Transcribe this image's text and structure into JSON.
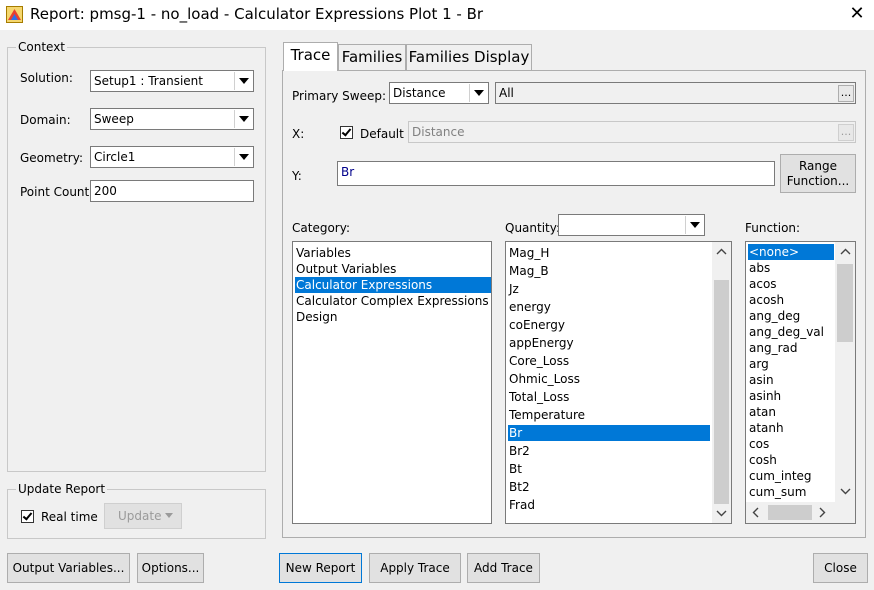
{
  "window": {
    "title": "Report: pmsg-1 - no_load - Calculator Expressions Plot 1 - Br",
    "close_glyph": "✕"
  },
  "context": {
    "group_label": "Context",
    "solution_label": "Solution:",
    "solution_value": "Setup1 : Transient",
    "domain_label": "Domain:",
    "domain_value": "Sweep",
    "geometry_label": "Geometry:",
    "geometry_value": "Circle1",
    "point_count_label": "Point Count:",
    "point_count_value": "200"
  },
  "update_report": {
    "group_label": "Update Report",
    "realtime_label": "Real time",
    "realtime_checked": true,
    "update_button": "Update"
  },
  "tabs": [
    {
      "label": "Trace",
      "active": true
    },
    {
      "label": "Families",
      "active": false
    },
    {
      "label": "Families Display",
      "active": false
    }
  ],
  "trace": {
    "primary_sweep_label": "Primary Sweep:",
    "primary_sweep_value": "Distance",
    "primary_sweep_range": "All",
    "dots": "...",
    "x_label": "X:",
    "default_label": "Default",
    "default_checked": true,
    "x_value": "Distance",
    "y_label": "Y:",
    "y_value": "Br",
    "range_function_button": "Range Function...",
    "category_label": "Category:",
    "quantity_label": "Quantity:",
    "quantity_filter": "",
    "function_label": "Function:",
    "categories": [
      "Variables",
      "Output Variables",
      "Calculator Expressions",
      "Calculator Complex Expressions",
      "Design"
    ],
    "category_selected": "Calculator Expressions",
    "quantities": [
      "Mag_H",
      "Mag_B",
      "Jz",
      "energy",
      "coEnergy",
      "appEnergy",
      "Core_Loss",
      "Ohmic_Loss",
      "Total_Loss",
      "Temperature",
      "Br",
      "Br2",
      "Bt",
      "Bt2",
      "Frad"
    ],
    "quantity_selected": "Br",
    "functions": [
      "<none>",
      "abs",
      "acos",
      "acosh",
      "ang_deg",
      "ang_deg_val",
      "ang_rad",
      "arg",
      "asin",
      "asinh",
      "atan",
      "atanh",
      "cos",
      "cosh",
      "cum_integ",
      "cum_sum"
    ],
    "function_selected": "<none>"
  },
  "bottom_buttons": {
    "output_variables": "Output Variables...",
    "options": "Options...",
    "new_report": "New Report",
    "apply_trace": "Apply Trace",
    "add_trace": "Add Trace",
    "close": "Close"
  },
  "colors": {
    "selection": "#0078d7",
    "window_bg": "#f0f0f0"
  }
}
